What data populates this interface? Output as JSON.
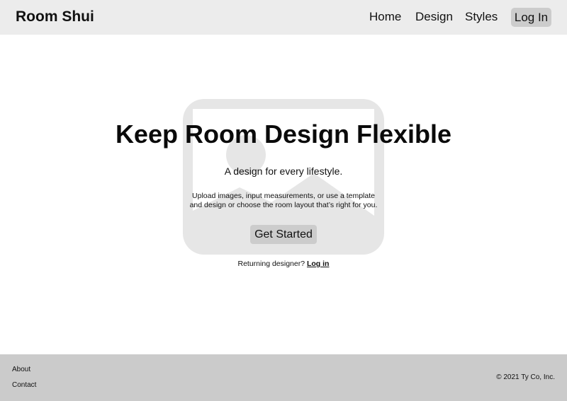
{
  "header": {
    "brand": "Room Shui",
    "nav": {
      "home": "Home",
      "design": "Design",
      "styles": "Styles",
      "login": "Log In"
    }
  },
  "hero": {
    "image_icon": "image-placeholder-icon",
    "title": "Keep Room Design Flexible",
    "subtitle": "A design for every lifestyle.",
    "description_line1": "Upload images, input measurements, or use a template",
    "description_line2": "and design or choose the room layout that’s right for you.",
    "cta": "Get Started",
    "returning_text": "Returning designer?",
    "returning_link": "Log in"
  },
  "footer": {
    "about": "About",
    "contact": "Contact",
    "copyright": "© 2021 Ty Co, Inc."
  },
  "colors": {
    "header_bg": "#ececec",
    "footer_bg": "#cbcbcb",
    "button_bg": "#cccccc",
    "placeholder_gray": "#e6e6e6"
  }
}
